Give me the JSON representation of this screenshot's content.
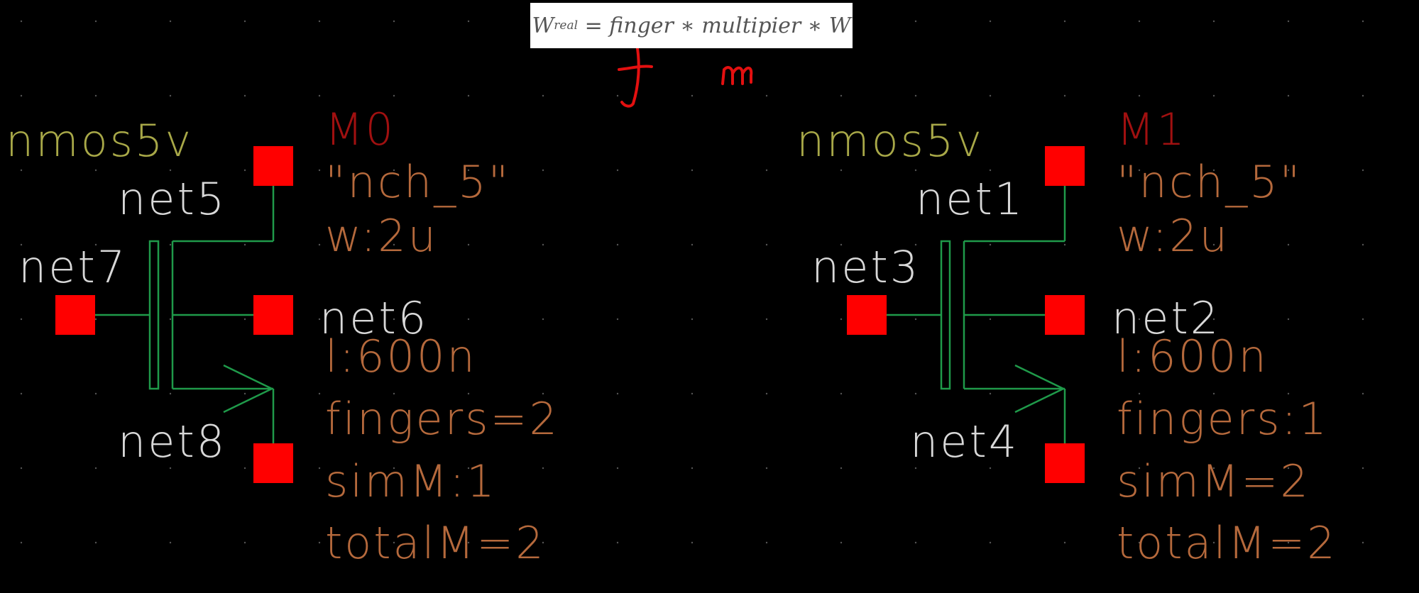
{
  "formula": {
    "lhs": "W",
    "lhs_sub": "real",
    "rhs": " = finger ∗ multipier ∗ W"
  },
  "annotations": {
    "f": "f",
    "m": "m"
  },
  "devices": [
    {
      "type": "nmos5v",
      "instance": "M0",
      "model": "\"nch_5\"",
      "w": "w:2u",
      "l": "l:600n",
      "fingers": "fingers=2",
      "simM": "simM:1",
      "totalM": "totalM=2",
      "drain_net": "net5",
      "gate_net": "net7",
      "bulk_net": "net6",
      "source_net": "net8"
    },
    {
      "type": "nmos5v",
      "instance": "M1",
      "model": "\"nch_5\"",
      "w": "w:2u",
      "l": "l:600n",
      "fingers": "fingers:1",
      "simM": "simM=2",
      "totalM": "totalM=2",
      "drain_net": "net1",
      "gate_net": "net3",
      "bulk_net": "net2",
      "source_net": "net4"
    }
  ],
  "colors": {
    "background": "#000000",
    "wire": "#1f9a4a",
    "pin": "#ff0000",
    "type_text": "#a8a848",
    "instance_text": "#a01010",
    "param_text": "#b5693c",
    "net_text": "#d8d8d8",
    "handwriting": "#e31010"
  }
}
